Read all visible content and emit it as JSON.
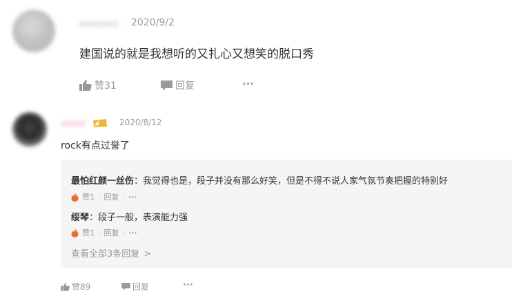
{
  "comment1": {
    "username": "xxxxxxx",
    "date": "2020/9/2",
    "text": "建国说的就是我想听的又扎心又想笑的脱口秀",
    "like_label": "赞31",
    "reply_label": "回复",
    "more_label": "···"
  },
  "comment2": {
    "username": "xxxxx",
    "date": "2020/8/12",
    "text": "rock有点过誉了",
    "replies": [
      {
        "author": "最怕红颜一丝伤",
        "text": "：我觉得也是，段子并没有那么好笑，但是不得不说人家气氛节奏把握的特别好",
        "like_label": "赞1",
        "sep": "·",
        "reply_label": "回复",
        "more_label": "···"
      },
      {
        "author": "绥琴",
        "text": "：段子一般，表演能力强",
        "like_label": "赞1",
        "sep": "·",
        "reply_label": "回复",
        "more_label": "···"
      }
    ],
    "view_all_label": "查看全部3条回复",
    "view_all_chevron": ">",
    "like_label": "赞89",
    "reply_label": "回复",
    "more_label": "···"
  },
  "colors": {
    "text_main": "#333333",
    "text_muted": "#999999",
    "reply_bg": "#f5f5f5",
    "flame": "#f06a2c",
    "badge": "#f0b53a",
    "username_blur": "#f48aa2"
  },
  "icons": [
    "thumbs-up-icon",
    "speech-bubble-icon",
    "flame-icon",
    "vip-badge-icon"
  ]
}
